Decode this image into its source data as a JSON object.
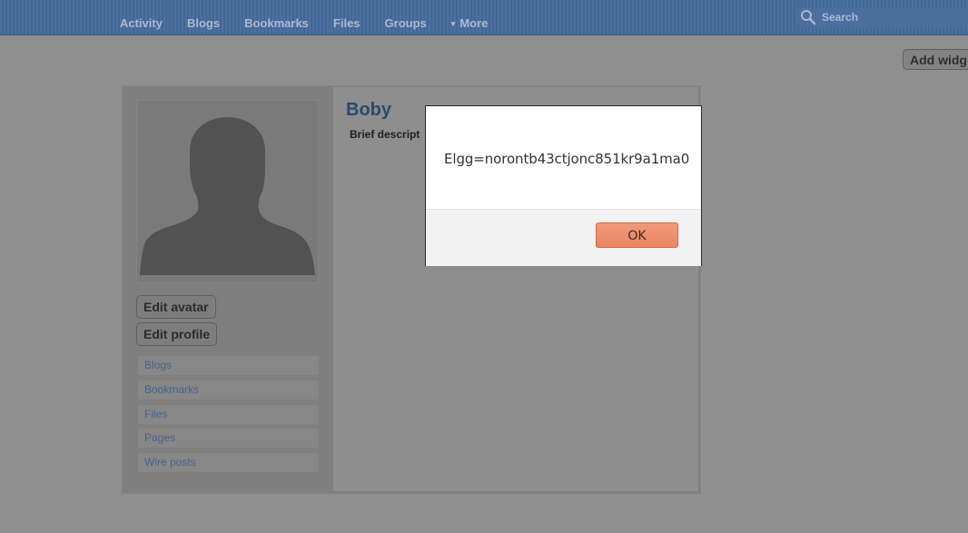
{
  "nav": {
    "items": [
      {
        "label": "Activity"
      },
      {
        "label": "Blogs"
      },
      {
        "label": "Bookmarks"
      },
      {
        "label": "Files"
      },
      {
        "label": "Groups"
      },
      {
        "label": "More",
        "icon": "caret-down-icon"
      }
    ],
    "search_placeholder": "Search",
    "search_icon": "magnifier-icon"
  },
  "widgets": {
    "add_label": "Add widg"
  },
  "profile": {
    "name": "Boby",
    "brief_description_label": "Brief descript",
    "avatar_icon": "default-user-silhouette-icon",
    "buttons": {
      "edit_avatar": "Edit avatar",
      "edit_profile": "Edit profile"
    },
    "menu": [
      {
        "label": "Blogs"
      },
      {
        "label": "Bookmarks"
      },
      {
        "label": "Files"
      },
      {
        "label": "Pages"
      },
      {
        "label": "Wire posts"
      }
    ]
  },
  "dialog": {
    "message": "Elgg=norontb43ctjonc851kr9a1ma0",
    "ok_label": "OK"
  },
  "colors": {
    "topbar": "#456a9b",
    "link": "#48628a",
    "ok_button": "#ea8562"
  }
}
